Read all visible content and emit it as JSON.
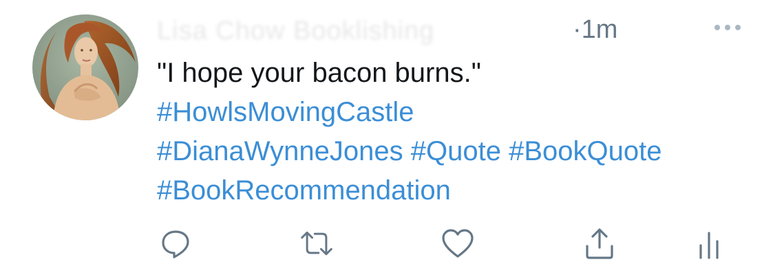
{
  "tweet": {
    "author_name_obscured": "Lisa Chow Booklishing",
    "separator": "·",
    "time": "1m",
    "text_line": "\"I hope your bacon burns.\"",
    "hashtags": [
      "#HowlsMovingCastle",
      "#DianaWynneJones",
      "#Quote",
      "#BookQuote",
      "#BookRecommendation"
    ]
  },
  "icons": {
    "more": "more-icon",
    "reply": "reply-icon",
    "retweet": "retweet-icon",
    "like": "heart-icon",
    "share": "share-icon",
    "analytics": "analytics-icon"
  },
  "colors": {
    "hashtag": "#3b8ed6",
    "icon": "#657786",
    "text": "#14171a"
  }
}
